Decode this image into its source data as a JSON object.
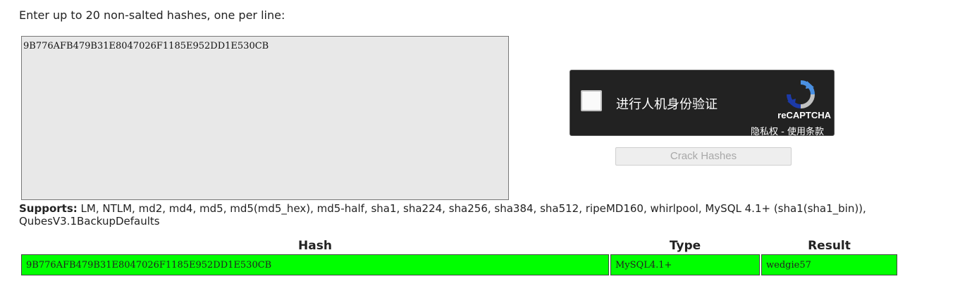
{
  "intro_text": "Enter up to 20 non-salted hashes, one per line:",
  "hash_input": {
    "value": "9B776AFB479B31E8047026F1185E952DD1E530CB"
  },
  "captcha": {
    "label": "进行人机身份验证",
    "brand": "reCAPTCHA",
    "privacy_link": "隐私权",
    "separator": " - ",
    "terms_link": "使用条款",
    "logo_icon": "recaptcha-logo-icon"
  },
  "crack_button": {
    "label": "Crack Hashes"
  },
  "supports": {
    "label": "Supports:",
    "text": " LM, NTLM, md2, md4, md5, md5(md5_hex), md5-half, sha1, sha224, sha256, sha384, sha512, ripeMD160, whirlpool, MySQL 4.1+ (sha1(sha1_bin)), QubesV3.1BackupDefaults"
  },
  "results_table": {
    "headers": {
      "hash": "Hash",
      "type": "Type",
      "result": "Result"
    },
    "rows": [
      {
        "hash": "9B776AFB479B31E8047026F1185E952DD1E530CB",
        "type": "MySQL4.1+",
        "result": "wedgie57"
      }
    ],
    "row_color": "#00ff00"
  }
}
